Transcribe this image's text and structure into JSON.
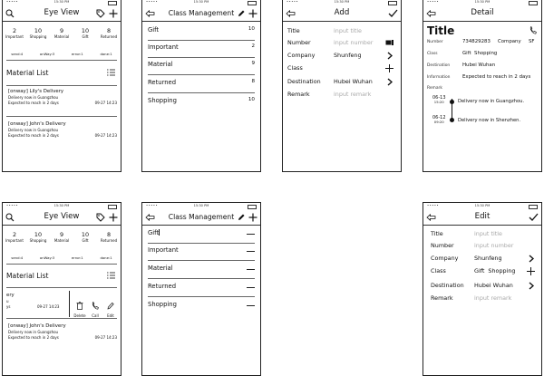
{
  "status_bar": {
    "time": "15:30 PM"
  },
  "home": {
    "title": "Eye View",
    "stats": [
      {
        "value": "2",
        "label": "Important"
      },
      {
        "value": "10",
        "label": "Shopping"
      },
      {
        "value": "9",
        "label": "Material"
      },
      {
        "value": "10",
        "label": "Gift"
      },
      {
        "value": "8",
        "label": "Returned"
      }
    ],
    "statuses": [
      "send:4",
      "onWay:3",
      "error:1",
      "done:1"
    ],
    "list_title": "Material List",
    "items": [
      {
        "title": "[onway] Lily's Delivery",
        "line1": "Delivery now in Guangzhou",
        "line2": "Expected to reach in 2 days",
        "date": "09-27 14:23"
      },
      {
        "title": "[onway] John's Delivery",
        "line1": "Delivery now in Guangzhou",
        "line2": "Expected to reach in 2 days",
        "date": "09-27 14:23"
      }
    ],
    "swiped": {
      "title": "ery",
      "line1": "u",
      "line2": "ys",
      "date": "09-27 14:23"
    },
    "actions": {
      "delete": "Delete",
      "call": "Call",
      "edit": "Edit"
    }
  },
  "class_management": {
    "title": "Class Management",
    "items": [
      {
        "name": "Gift",
        "count": "10"
      },
      {
        "name": "Important",
        "count": "2"
      },
      {
        "name": "Material",
        "count": "9"
      },
      {
        "name": "Returned",
        "count": "8"
      },
      {
        "name": "Shopping",
        "count": "10"
      }
    ],
    "edit_items": [
      "Gift",
      "Important",
      "Material",
      "Returned",
      "Shopping"
    ]
  },
  "add": {
    "title": "Add",
    "fields": {
      "title_label": "Title",
      "title_placeholder": "input title",
      "number_label": "Number",
      "number_placeholder": "input number",
      "company_label": "Company",
      "company_value": "Shunfeng",
      "class_label": "Class",
      "destination_label": "Destination",
      "destination_value": "Hubei Wuhan",
      "remark_label": "Remark",
      "remark_placeholder": "input remark"
    }
  },
  "detail": {
    "nav_title": "Detail",
    "heading": "Title",
    "number_label": "Number",
    "number_value": "734829283",
    "company_label": "Company",
    "company_value": "SF",
    "class_label": "Class",
    "class_value": "Gift  Shopping",
    "destination_label": "Destination",
    "destination_value": "Hubei Wuhan",
    "information_label": "Information",
    "information_value": "Expected to reach in 2 days",
    "remark_label": "Remark",
    "timeline": [
      {
        "date": "06-13",
        "time": "15:20",
        "text": "Delivery now in Guangzhou."
      },
      {
        "date": "06-12",
        "time": "09:20",
        "text": "Delivery now in Shenzhen."
      }
    ]
  },
  "edit": {
    "title": "Edit",
    "title_label": "Title",
    "title_placeholder": "input title",
    "number_label": "Number",
    "number_placeholder": "input number",
    "company_label": "Company",
    "company_value": "Shunfeng",
    "class_label": "Class",
    "class_value": "Gift  Shopping",
    "destination_label": "Destination",
    "destination_value": "Hubei Wuhan",
    "remark_label": "Remark",
    "remark_placeholder": "input remark"
  }
}
